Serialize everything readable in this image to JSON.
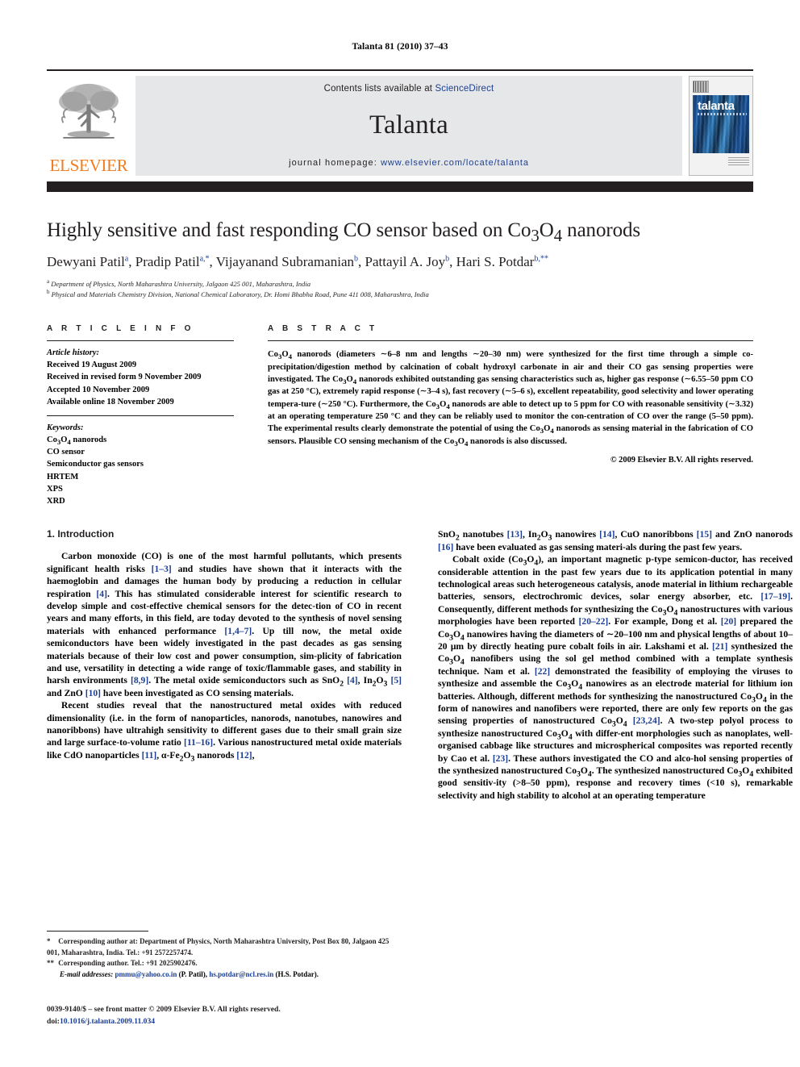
{
  "running_head": "Talanta 81 (2010) 37–43",
  "masthead": {
    "publisher_name": "ELSEVIER",
    "contents_prefix": "Contents lists available at ",
    "contents_link": "ScienceDirect",
    "journal_name": "Talanta",
    "homepage_prefix": "journal homepage: ",
    "homepage_url": "www.elsevier.com/locate/talanta",
    "cover_title": "talanta"
  },
  "article": {
    "title": "Highly sensitive and fast responding CO sensor based on Co3O4 nanorods",
    "authors_html": "Dewyani Patil<sup>a</sup>, Pradip Patil<sup>a,</sup><sup>*</sup>, Vijayanand Subramanian<sup>b</sup>, Pattayil A. Joy<sup>b</sup>, Hari S. Potdar<sup>b,</sup><sup>**</sup>",
    "affiliation_a": "Department of Physics, North Maharashtra University, Jalgaon 425 001, Maharashtra, India",
    "affiliation_b": "Physical and Materials Chemistry Division, National Chemical Laboratory, Dr. Homi Bhabha Road, Pune 411 008, Maharashtra, India"
  },
  "article_info": {
    "heading": "A R T I C L E  I N F O",
    "history_label": "Article history:",
    "history": [
      "Received 19 August 2009",
      "Received in revised form 9 November 2009",
      "Accepted 10 November 2009",
      "Available online 18 November 2009"
    ],
    "keywords_label": "Keywords:",
    "keywords_html": [
      "Co<sub>3</sub>O<sub>4</sub> nanorods",
      "CO sensor",
      "Semiconductor gas sensors",
      "HRTEM",
      "XPS",
      "XRD"
    ]
  },
  "abstract": {
    "heading": "A B S T R A C T",
    "text_html": "Co<sub>3</sub>O<sub>4</sub> nanorods (diameters ∼6–8 nm and lengths ∼20–30 nm) were synthesized for the first time through a simple co-precipitation/digestion method by calcination of cobalt hydroxyl carbonate in air and their CO gas sensing properties were investigated. The Co<sub>3</sub>O<sub>4</sub> nanorods exhibited outstanding gas sensing characteristics such as, higher gas response (∼6.55–50 ppm CO gas at 250 °C), extremely rapid response (∼3–4 s), fast recovery (∼5–6 s), excellent repeatability, good selectivity and lower operating tempera-ture (∼250 °C). Furthermore, the Co<sub>3</sub>O<sub>4</sub> nanorods are able to detect up to 5 ppm for CO with reasonable sensitivity (∼3.32) at an operating temperature 250 °C and they can be reliably used to monitor the con-centration of CO over the range (5–50 ppm). The experimental results clearly demonstrate the potential of using the Co<sub>3</sub>O<sub>4</sub> nanorods as sensing material in the fabrication of CO sensors. Plausible CO sensing mechanism of the Co<sub>3</sub>O<sub>4</sub> nanorods is also discussed.",
    "copyright": "© 2009 Elsevier B.V. All rights reserved."
  },
  "introduction": {
    "section_title": "1.  Introduction",
    "left_paragraphs_html": [
      "Carbon monoxide (CO) is one of the most harmful pollutants, which presents significant health risks <span class=\"ref\">[1–3]</span> and studies have shown that it interacts with the haemoglobin and damages the human body by producing a reduction in cellular respiration <span class=\"ref\">[4]</span>. This has stimulated considerable interest for scientific research to develop simple and cost-effective chemical sensors for the detec-tion of CO in recent years and many efforts, in this field, are today devoted to the synthesis of novel sensing materials with enhanced performance <span class=\"ref\">[1,4–7]</span>. Up till now, the metal oxide semiconductors have been widely investigated in the past decades as gas sensing materials because of their low cost and power consumption, sim-plicity of fabrication and use, versatility in detecting a wide range of toxic/flammable gases, and stability in harsh environments <span class=\"ref\">[8,9]</span>. The metal oxide semiconductors such as SnO<sub>2</sub> <span class=\"ref\">[4]</span>, In<sub>2</sub>O<sub>3</sub> <span class=\"ref\">[5]</span> and ZnO <span class=\"ref\">[10]</span> have been investigated as CO sensing materials.",
      "Recent studies reveal that the nanostructured metal oxides with reduced dimensionality (i.e. in the form of nanoparticles, nanorods, nanotubes, nanowires and nanoribbons) have ultrahigh sensitivity to different gases due to their small grain size and large surface-to-volume ratio <span class=\"ref\">[11–16]</span>. Various nanostructured metal oxide materials like CdO nanoparticles <span class=\"ref\">[11]</span>, α-Fe<sub>2</sub>O<sub>3</sub> nanorods <span class=\"ref\">[12]</span>,"
    ],
    "right_paragraphs_html": [
      "SnO<sub>2</sub> nanotubes <span class=\"ref\">[13]</span>, In<sub>2</sub>O<sub>3</sub> nanowires <span class=\"ref\">[14]</span>, CuO nanoribbons <span class=\"ref\">[15]</span> and ZnO nanorods <span class=\"ref\">[16]</span> have been evaluated as gas sensing materi-als during the past few years.",
      "Cobalt oxide (Co<sub>3</sub>O<sub>4</sub>), an important magnetic p-type semicon-ductor, has received considerable attention in the past few years due to its application potential in many technological areas such heterogeneous catalysis, anode material in lithium rechargeable batteries, sensors, electrochromic devices, solar energy absorber, etc. <span class=\"ref\">[17–19]</span>. Consequently, different methods for synthesizing the Co<sub>3</sub>O<sub>4</sub> nanostructures with various morphologies have been reported <span class=\"ref\">[20–22]</span>. For example, Dong et al. <span class=\"ref\">[20]</span> prepared the Co<sub>3</sub>O<sub>4</sub> nanowires having the diameters of ∼20–100 nm and physical lengths of about 10–20 μm by directly heating pure cobalt foils in air. Lakshami et al. <span class=\"ref\">[21]</span> synthesized the Co<sub>3</sub>O<sub>4</sub> nanofibers using the sol gel method combined with a template synthesis technique. Nam et al. <span class=\"ref\">[22]</span> demonstrated the feasibility of employing the viruses to synthesize and assemble the Co<sub>3</sub>O<sub>4</sub> nanowires as an electrode material for lithium ion batteries. Although, different methods for synthesizing the nanostructured Co<sub>3</sub>O<sub>4</sub> in the form of nanowires and nanofibers were reported, there are only few reports on the gas sensing properties of nanostructured Co<sub>3</sub>O<sub>4</sub> <span class=\"ref\">[23,24]</span>. A two-step polyol process to synthesize nanostructured Co<sub>3</sub>O<sub>4</sub> with differ-ent morphologies such as nanoplates, well-organised cabbage like structures and microspherical composites was reported recently by Cao et al. <span class=\"ref\">[23]</span>. These authors investigated the CO and alco-hol sensing properties of the synthesized nanostructured Co<sub>3</sub>O<sub>4</sub>. The synthesized nanostructured Co<sub>3</sub>O<sub>4</sub> exhibited good sensitiv-ity (&gt;8–50 ppm), response and recovery times (&lt;10 s), remarkable selectivity and high stability to alcohol at an operating temperature"
    ]
  },
  "footnotes": {
    "corresponding_1_html": "<span class=\"ind\">*</span> Corresponding author at: Department of Physics, North Maharashtra University, Post Box 80, Jalgaon 425 001, Maharashtra, India. Tel.: +91 2572257474.",
    "corresponding_2_html": "<span class=\"ind\">**</span> Corresponding author. Tel.: +91 2025902476.",
    "email_html": "<i>E-mail addresses:</i> <span class=\"mail\">pmmu@yahoo.co.in</span> (P. Patil), <span class=\"mail\">hs.potdar@ncl.res.in</span> (H.S. Potdar)."
  },
  "imprint": {
    "front_matter": "0039-9140/$ – see front matter © 2009 Elsevier B.V. All rights reserved.",
    "doi_label": "doi:",
    "doi_value": "10.1016/j.talanta.2009.11.034"
  }
}
